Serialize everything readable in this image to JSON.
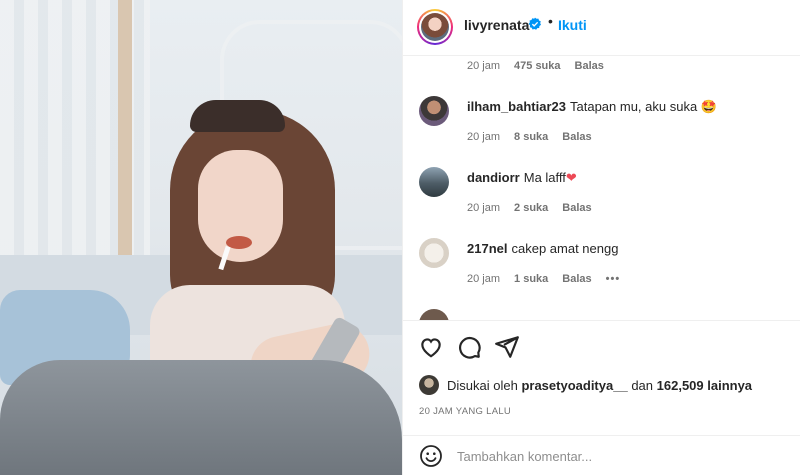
{
  "post_image": {
    "description_icon": "photo"
  },
  "header": {
    "username": "livyrenata",
    "dot": "•",
    "follow_label": "Ikuti"
  },
  "comments": [
    {
      "username": "",
      "text": "",
      "time": "20 jam",
      "likes": "475 suka",
      "reply": "Balas",
      "emoji": ""
    },
    {
      "username": "ilham_bahtiar23",
      "text": "Tatapan mu, aku suka",
      "emoji": "🤩",
      "time": "20 jam",
      "likes": "8 suka",
      "reply": "Balas"
    },
    {
      "username": "dandiorr",
      "text": "Ma lafff",
      "emoji": "❤",
      "time": "20 jam",
      "likes": "2 suka",
      "reply": "Balas"
    },
    {
      "username": "217nel",
      "text": "cakep amat nengg",
      "emoji": "",
      "time": "20 jam",
      "likes": "1 suka",
      "reply": "Balas",
      "more": "•••"
    }
  ],
  "likes_line": {
    "prefix": "Disukai oleh",
    "user": "prasetyoaditya__",
    "connector": "dan",
    "count": "162,509 lainnya"
  },
  "time_ago": "20 JAM YANG LALU",
  "add_comment": {
    "placeholder": "Tambahkan komentar..."
  },
  "colors": {
    "accent": "#0095f6",
    "text": "#262626",
    "muted": "#737373",
    "heart": "#ed4956"
  }
}
